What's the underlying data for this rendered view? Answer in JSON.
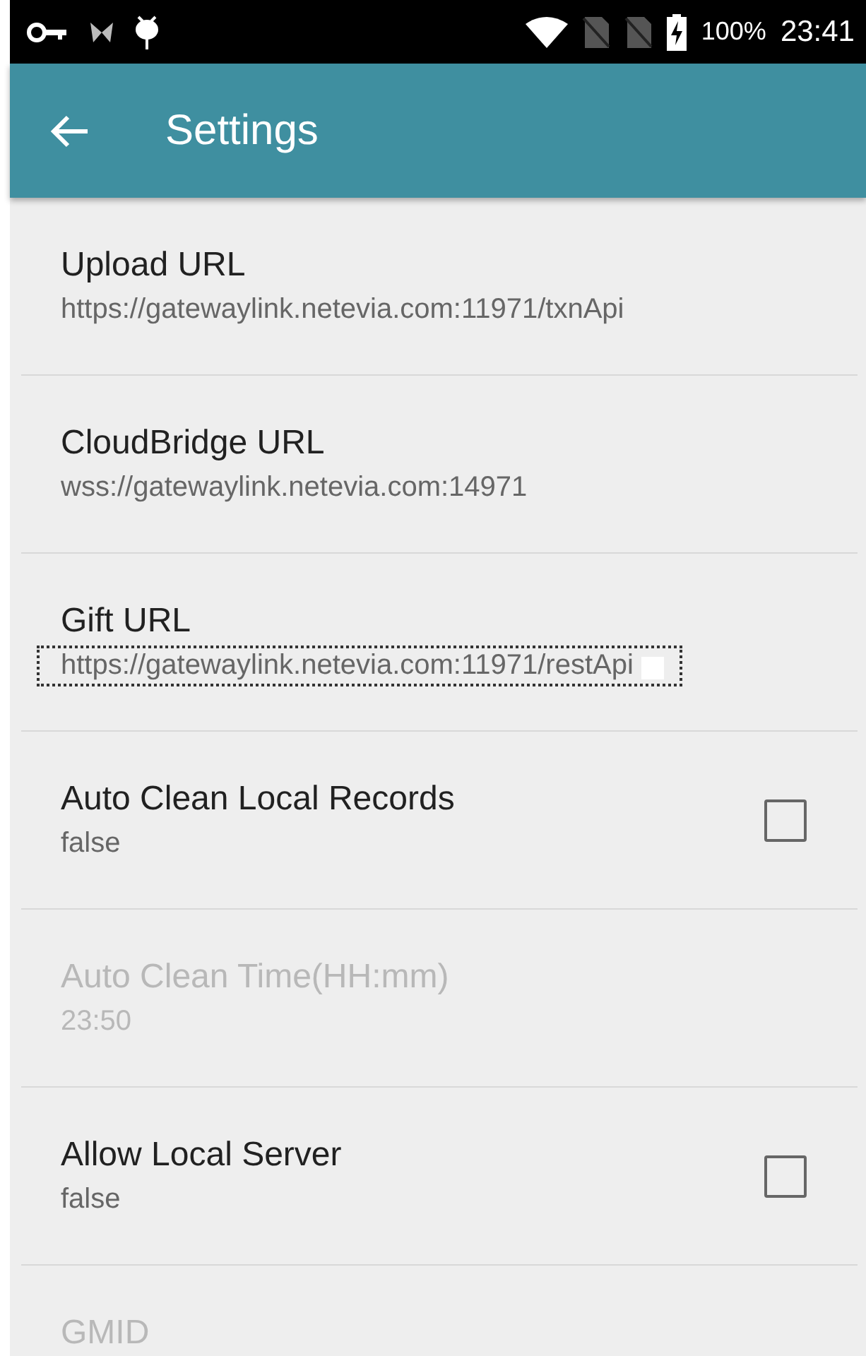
{
  "status_bar": {
    "battery": "100%",
    "time": "23:41"
  },
  "app_bar": {
    "title": "Settings"
  },
  "preferences": [
    {
      "kind": "text",
      "title": "Upload URL",
      "summary": "https://gatewaylink.netevia.com:11971/txnApi",
      "disabled": false
    },
    {
      "kind": "text",
      "title": "CloudBridge URL",
      "summary": "wss://gatewaylink.netevia.com:14971",
      "disabled": false
    },
    {
      "kind": "text",
      "title": "Gift URL",
      "summary": "https://gatewaylink.netevia.com:11971/restApi",
      "disabled": false,
      "focused": true
    },
    {
      "kind": "checkbox",
      "title": "Auto Clean Local Records",
      "summary": "false",
      "disabled": false,
      "checked": false
    },
    {
      "kind": "text",
      "title": "Auto Clean Time(HH:mm)",
      "summary": "23:50",
      "disabled": true
    },
    {
      "kind": "checkbox",
      "title": "Allow Local Server",
      "summary": "false",
      "disabled": false,
      "checked": false
    },
    {
      "kind": "text",
      "title": "GMID",
      "disabled": true
    }
  ]
}
